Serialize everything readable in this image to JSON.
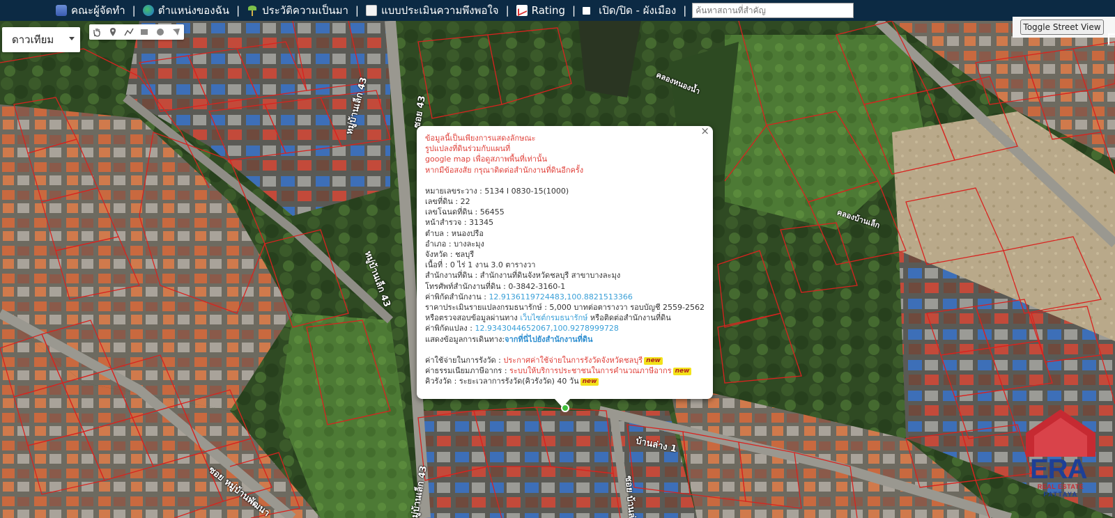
{
  "nav": {
    "items": [
      {
        "label": "คณะผู้จัดทำ",
        "icon": "team-icon"
      },
      {
        "label": "ตำแหน่งของฉัน",
        "icon": "globe-icon"
      },
      {
        "label": "ประวัติความเป็นมา",
        "icon": "plant-icon"
      },
      {
        "label": "แบบประเมินความพึงพอใจ",
        "icon": "document-icon"
      },
      {
        "label": "Rating",
        "icon": "chart-icon"
      },
      {
        "label": "เปิด/ปิด - ผังเมือง",
        "icon": "checkbox-icon"
      }
    ],
    "search_placeholder": "ค้นหาสถานที่สำคัญ"
  },
  "map_controls": {
    "map_type": "ดาวเทียม",
    "street_view_button": "Toggle Street View"
  },
  "road_labels": {
    "soi_43_top": "ซอย 43",
    "soi_43_upper": "หมู่บ้านเล็ก 43",
    "soi_43_mid": "หมู่บ้านเล็ก 43",
    "soi_43_bottom": "หมู่บ้านเล็ก 43",
    "ban_lang_1": "บ้านล่าง 1",
    "soi_ban_lang": "ซอย บ้านล่าง",
    "soi_moo_ban": "ซอย หมู่บ้านพัฒนา",
    "canal_top": "คลองหนองน้ำ",
    "canal_right": "คลองบ้านเล็ก"
  },
  "info_window": {
    "disclaimer": [
      "ข้อมูลนี้เป็นเพียงการแสดงลักษณะ",
      "รูปแปลงที่ดินร่วมกับแผนที่",
      "google map เพื่อดูสภาพพื้นที่เท่านั้น",
      "หากมีข้อสงสัย กรุณาติดต่อสำนักงานที่ดินอีกครั้ง"
    ],
    "fields": {
      "map_sheet_label": "หมายเลขระวาง",
      "map_sheet_value": "5134 I 0830-15(1000)",
      "land_no_label": "เลขที่ดิน",
      "land_no_value": "22",
      "deed_no_label": "เลขโฉนดที่ดิน",
      "deed_no_value": "56455",
      "survey_label": "หน้าสำรวจ",
      "survey_value": "31345",
      "subdistrict_label": "ตำบล",
      "subdistrict_value": "หนองปรือ",
      "district_label": "อำเภอ",
      "district_value": "บางละมุง",
      "province_label": "จังหวัด",
      "province_value": "ชลบุรี",
      "area_label": "เนื้อที่",
      "area_value": "0 ไร่ 1 งาน 3.0 ตารางวา",
      "office_label": "สำนักงานที่ดิน",
      "office_value": "สำนักงานที่ดินจังหวัดชลบุรี สาขาบางละมุง",
      "phone_label": "โทรศัพท์สำนักงานที่ดิน",
      "phone_value": "0-3842-3160-1",
      "office_coord_label": "ค่าพิกัดสำนักงาน",
      "office_coord_value": "12.9136119724483,100.8821513366",
      "appraisal_label": "ราคาประเมินรายแปลงกรมธนารักษ์",
      "appraisal_value": "5,000 บาทต่อตารางวา รอบบัญชี 2559-2562",
      "check_prefix": "หรือตรวจสอบข้อมูลผ่านทาง",
      "check_link": "เว็บไซต์กรมธนารักษ์",
      "check_suffix": "หรือติดต่อสำนักงานที่ดิน",
      "parcel_coord_label": "ค่าพิกัดแปลง",
      "parcel_coord_value": "12.9343044652067,100.9278999728",
      "route_prefix": "แสดงข้อมูลการเดินทาง",
      "route_link": "จากที่นี่ไปยังสำนักงานที่ดิน",
      "survey_fee_label": "ค่าใช้จ่ายในการรังวัด",
      "survey_fee_link": "ประกาศค่าใช้จ่ายในการรังวัดจังหวัดชลบุรี",
      "tax_label": "ค่าธรรมเนียมภาษีอากร",
      "tax_link": "ระบบให้บริการประชาชนในการคำนวณภาษีอากร",
      "queue_label": "คิวรังวัด",
      "queue_value": "ระยะเวลาการรังวัด(คิวรังวัด) 40 วัน",
      "new_badge": "new",
      "close": "×"
    }
  },
  "logo": {
    "text": "ERA",
    "sub1": "REAL ESTATE",
    "sub2": "PATTAYA"
  },
  "colors": {
    "topbar": "#0c2a44",
    "parcel_lines": "#d8231f",
    "warning_text": "#e0413a",
    "link_blue": "#3aa0d8",
    "era_blue": "#1e3f96",
    "era_red": "#c62a32"
  }
}
